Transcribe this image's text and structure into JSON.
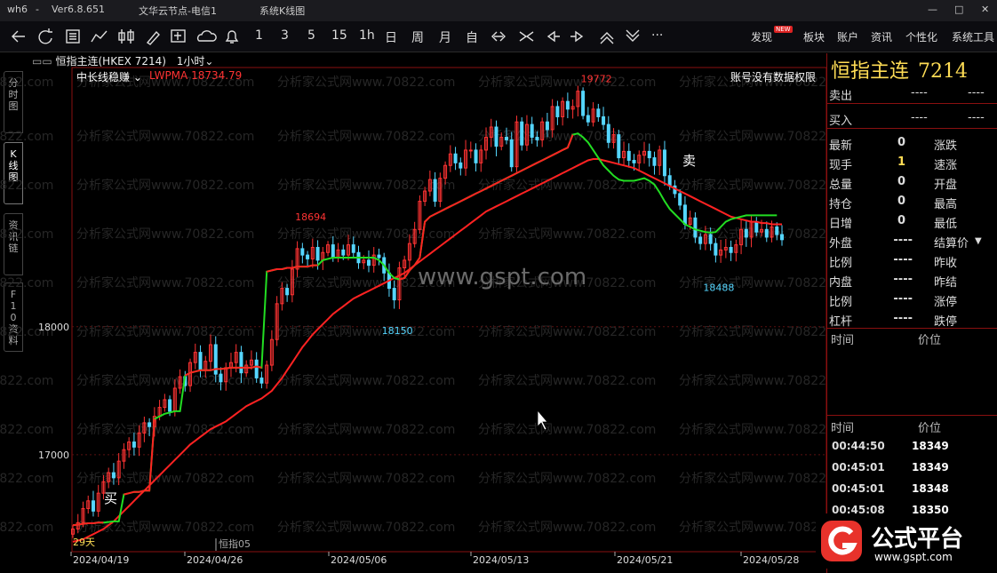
{
  "titlebar": {
    "app": "wh6",
    "dash": "-",
    "version": "Ver6.8.651",
    "server": "文华云节点-电信1",
    "window": "系统K线图",
    "min": "—",
    "max": "□",
    "close": "✕"
  },
  "toolbar": {
    "periods": [
      "1",
      "3",
      "5",
      "15",
      "1h",
      "日",
      "周",
      "月",
      "自"
    ],
    "more": "···",
    "menu": [
      "发现",
      "板块",
      "账户",
      "资讯",
      "个性化",
      "系统工具"
    ],
    "new_badge": "NEW"
  },
  "left_tabs": [
    "分时图",
    "K线图",
    "资讯链",
    "F10资料"
  ],
  "chart_header": {
    "symbol": "恒指主连(HKEX 7214)",
    "period": "1小时",
    "indicator": "中长线稳赚",
    "lwpma": "LWPMA 18734.79",
    "no_permission": "账号没有数据权限"
  },
  "watermark": {
    "text": "分析家公式网www.70822.com",
    "center": "www.gspt.com"
  },
  "chart_labels": {
    "buy": "买",
    "sell": "卖",
    "days": "29天",
    "bottom_label": "恒指05"
  },
  "chart_data": {
    "type": "line",
    "x_labels": [
      "2024/04/19",
      "2024/04/26",
      "2024/05/06",
      "2024/05/13",
      "2024/05/21",
      "2024/05/28"
    ],
    "y_ticks": [
      18000,
      17000
    ],
    "ylim": [
      16250,
      19900
    ],
    "peaks": [
      {
        "label": "18694",
        "value": 18694,
        "i": 46
      },
      {
        "label": "18150",
        "value": 18150,
        "i": 63
      },
      {
        "label": "19772",
        "value": 19772,
        "i": 102
      },
      {
        "label": "18488",
        "value": 18488,
        "i": 126
      }
    ],
    "close": [
      16420,
      16470,
      16580,
      16640,
      16560,
      16700,
      16790,
      16860,
      16820,
      16950,
      17040,
      17100,
      17060,
      17170,
      17250,
      17220,
      17300,
      17370,
      17430,
      17340,
      17520,
      17610,
      17540,
      17720,
      17800,
      17660,
      17730,
      17860,
      17630,
      17570,
      17680,
      17720,
      17800,
      17640,
      17700,
      17740,
      17600,
      17560,
      17700,
      17900,
      18180,
      18300,
      18250,
      18450,
      18610,
      18560,
      18530,
      18620,
      18520,
      18580,
      18640,
      18540,
      18600,
      18560,
      18640,
      18580,
      18500,
      18520,
      18480,
      18560,
      18540,
      18420,
      18300,
      18210,
      18460,
      18520,
      18650,
      18760,
      18980,
      19060,
      19150,
      18980,
      19160,
      19260,
      19350,
      19280,
      19240,
      19380,
      19380,
      19280,
      19380,
      19480,
      19560,
      19410,
      19480,
      19460,
      19250,
      19600,
      19420,
      19580,
      19480,
      19460,
      19600,
      19540,
      19720,
      19640,
      19760,
      19700,
      19720,
      19840,
      19650,
      19600,
      19700,
      19640,
      19580,
      19440,
      19500,
      19320,
      19370,
      19300,
      19280,
      19340,
      19370,
      19320,
      19260,
      19380,
      19180,
      19100,
      19040,
      18950,
      18800,
      18850,
      18700,
      18650,
      18720,
      18650,
      18560,
      18600,
      18620,
      18580,
      18640,
      18760,
      18700,
      18820,
      18740,
      18760,
      18700,
      18780,
      18720,
      18680
    ],
    "green_line": [
      16450,
      16455,
      16460,
      16465,
      16465,
      16470,
      16470,
      16475,
      16480,
      16480,
      16690,
      16700,
      16710,
      16710,
      16720,
      16720,
      17280,
      17300,
      17320,
      17330,
      17340,
      17340,
      17620,
      17640,
      17650,
      17660,
      17660,
      17660,
      17670,
      17670,
      17675,
      17680,
      17680,
      17680,
      17680,
      17680,
      17690,
      17680,
      18430,
      18440,
      18450,
      18450,
      18460,
      18460,
      18470,
      18470,
      18470,
      18480,
      18480,
      18520,
      18530,
      18540,
      18540,
      18540,
      18540,
      18540,
      18540,
      18540,
      18540,
      18540,
      18520,
      18480,
      18420,
      18380,
      18370,
      18380,
      18440,
      18480,
      18540,
      18820,
      18860,
      18880,
      18900,
      18920,
      18940,
      18960,
      18980,
      19000,
      19020,
      19040,
      19060,
      19080,
      19100,
      19120,
      19140,
      19160,
      19180,
      19200,
      19220,
      19240,
      19260,
      19280,
      19300,
      19320,
      19340,
      19360,
      19380,
      19400,
      19500,
      19510,
      19480,
      19440,
      19380,
      19320,
      19260,
      19220,
      19180,
      19150,
      19140,
      19140,
      19140,
      19150,
      19160,
      19140,
      19110,
      19050,
      18980,
      18920,
      18880,
      18840,
      18800,
      18780,
      18760,
      18750,
      18740,
      18735,
      18740,
      18780,
      18820,
      18840,
      18850,
      18860,
      18870,
      18870,
      18870,
      18870,
      18870,
      18870,
      18870
    ],
    "red_line": [
      16320,
      16330,
      16340,
      16360,
      16380,
      16400,
      16420,
      16450,
      16480,
      16520,
      16560,
      16600,
      16640,
      16680,
      16720,
      16760,
      16800,
      16840,
      16880,
      16920,
      16960,
      17000,
      17040,
      17080,
      17110,
      17140,
      17170,
      17200,
      17220,
      17240,
      17260,
      17290,
      17320,
      17350,
      17380,
      17400,
      17420,
      17440,
      17470,
      17500,
      17550,
      17600,
      17660,
      17720,
      17780,
      17840,
      17890,
      17940,
      17980,
      18020,
      18060,
      18100,
      18130,
      18160,
      18190,
      18220,
      18240,
      18260,
      18280,
      18300,
      18320,
      18340,
      18360,
      18380,
      18400,
      18420,
      18450,
      18480,
      18510,
      18540,
      18570,
      18600,
      18630,
      18660,
      18690,
      18720,
      18750,
      18780,
      18810,
      18840,
      18870,
      18900,
      18920,
      18940,
      18960,
      18980,
      19000,
      19020,
      19040,
      19060,
      19080,
      19100,
      19120,
      19140,
      19160,
      19180,
      19200,
      19220,
      19240,
      19260,
      19280,
      19300,
      19310,
      19310,
      19300,
      19290,
      19280,
      19270,
      19260,
      19250,
      19240,
      19220,
      19200,
      19180,
      19160,
      19140,
      19120,
      19100,
      19080,
      19060,
      19040,
      19020,
      19000,
      18980,
      18960,
      18940,
      18920,
      18900,
      18880,
      18860,
      18850,
      18840,
      18830,
      18820,
      18820,
      18810,
      18810,
      18800,
      18800,
      18800
    ]
  },
  "right_panel": {
    "title": "恒指主连",
    "code": "7214",
    "sell": {
      "label": "卖出",
      "v1": "----",
      "v2": "----"
    },
    "buy": {
      "label": "买入",
      "v1": "----",
      "v2": "----"
    },
    "rows": [
      {
        "l1": "最新",
        "v1": "0",
        "l2": "涨跌",
        "v2": ""
      },
      {
        "l1": "现手",
        "v1": "1",
        "l2": "速涨",
        "v2": ""
      },
      {
        "l1": "总量",
        "v1": "0",
        "l2": "开盘",
        "v2": ""
      },
      {
        "l1": "持仓",
        "v1": "0",
        "l2": "最高",
        "v2": ""
      },
      {
        "l1": "日增",
        "v1": "0",
        "l2": "最低",
        "v2": ""
      },
      {
        "l1": "外盘",
        "v1": "----",
        "l2": "结算价",
        "v2": ""
      },
      {
        "l1": "比例",
        "v1": "----",
        "l2": "昨收",
        "v2": ""
      },
      {
        "l1": "内盘",
        "v1": "----",
        "l2": "昨结",
        "v2": ""
      },
      {
        "l1": "比例",
        "v1": "----",
        "l2": "涨停",
        "v2": ""
      },
      {
        "l1": "杠杆",
        "v1": "----",
        "l2": "跌停",
        "v2": ""
      }
    ],
    "tick_header": {
      "time": "时间",
      "price": "价位"
    },
    "trades": [
      {
        "time": "00:44:50",
        "price": "18349"
      },
      {
        "time": "00:45:01",
        "price": "18349"
      },
      {
        "time": "00:45:01",
        "price": "18348"
      },
      {
        "time": "00:45:08",
        "price": "18350"
      }
    ]
  },
  "logo": {
    "name": "公式平台",
    "url": "www.gspt.com"
  },
  "colors": {
    "up": "#ff3333",
    "down": "#55d6ff",
    "green": "#22dd22",
    "red_line": "#ff2222",
    "frame": "#8a1010",
    "yellow": "#ffdd55"
  }
}
